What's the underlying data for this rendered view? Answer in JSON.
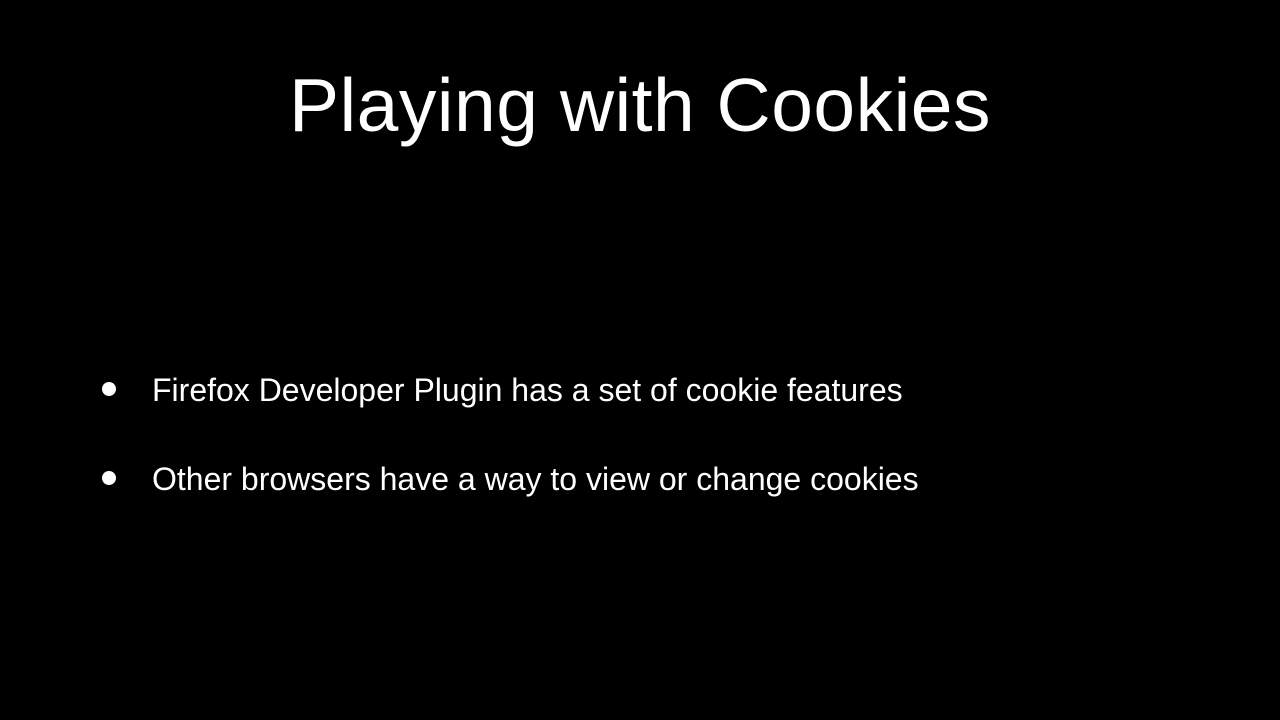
{
  "slide": {
    "title": "Playing with Cookies",
    "bullets": [
      "Firefox Developer Plugin has a set of cookie features",
      "Other browsers have a way to view or change cookies"
    ]
  }
}
